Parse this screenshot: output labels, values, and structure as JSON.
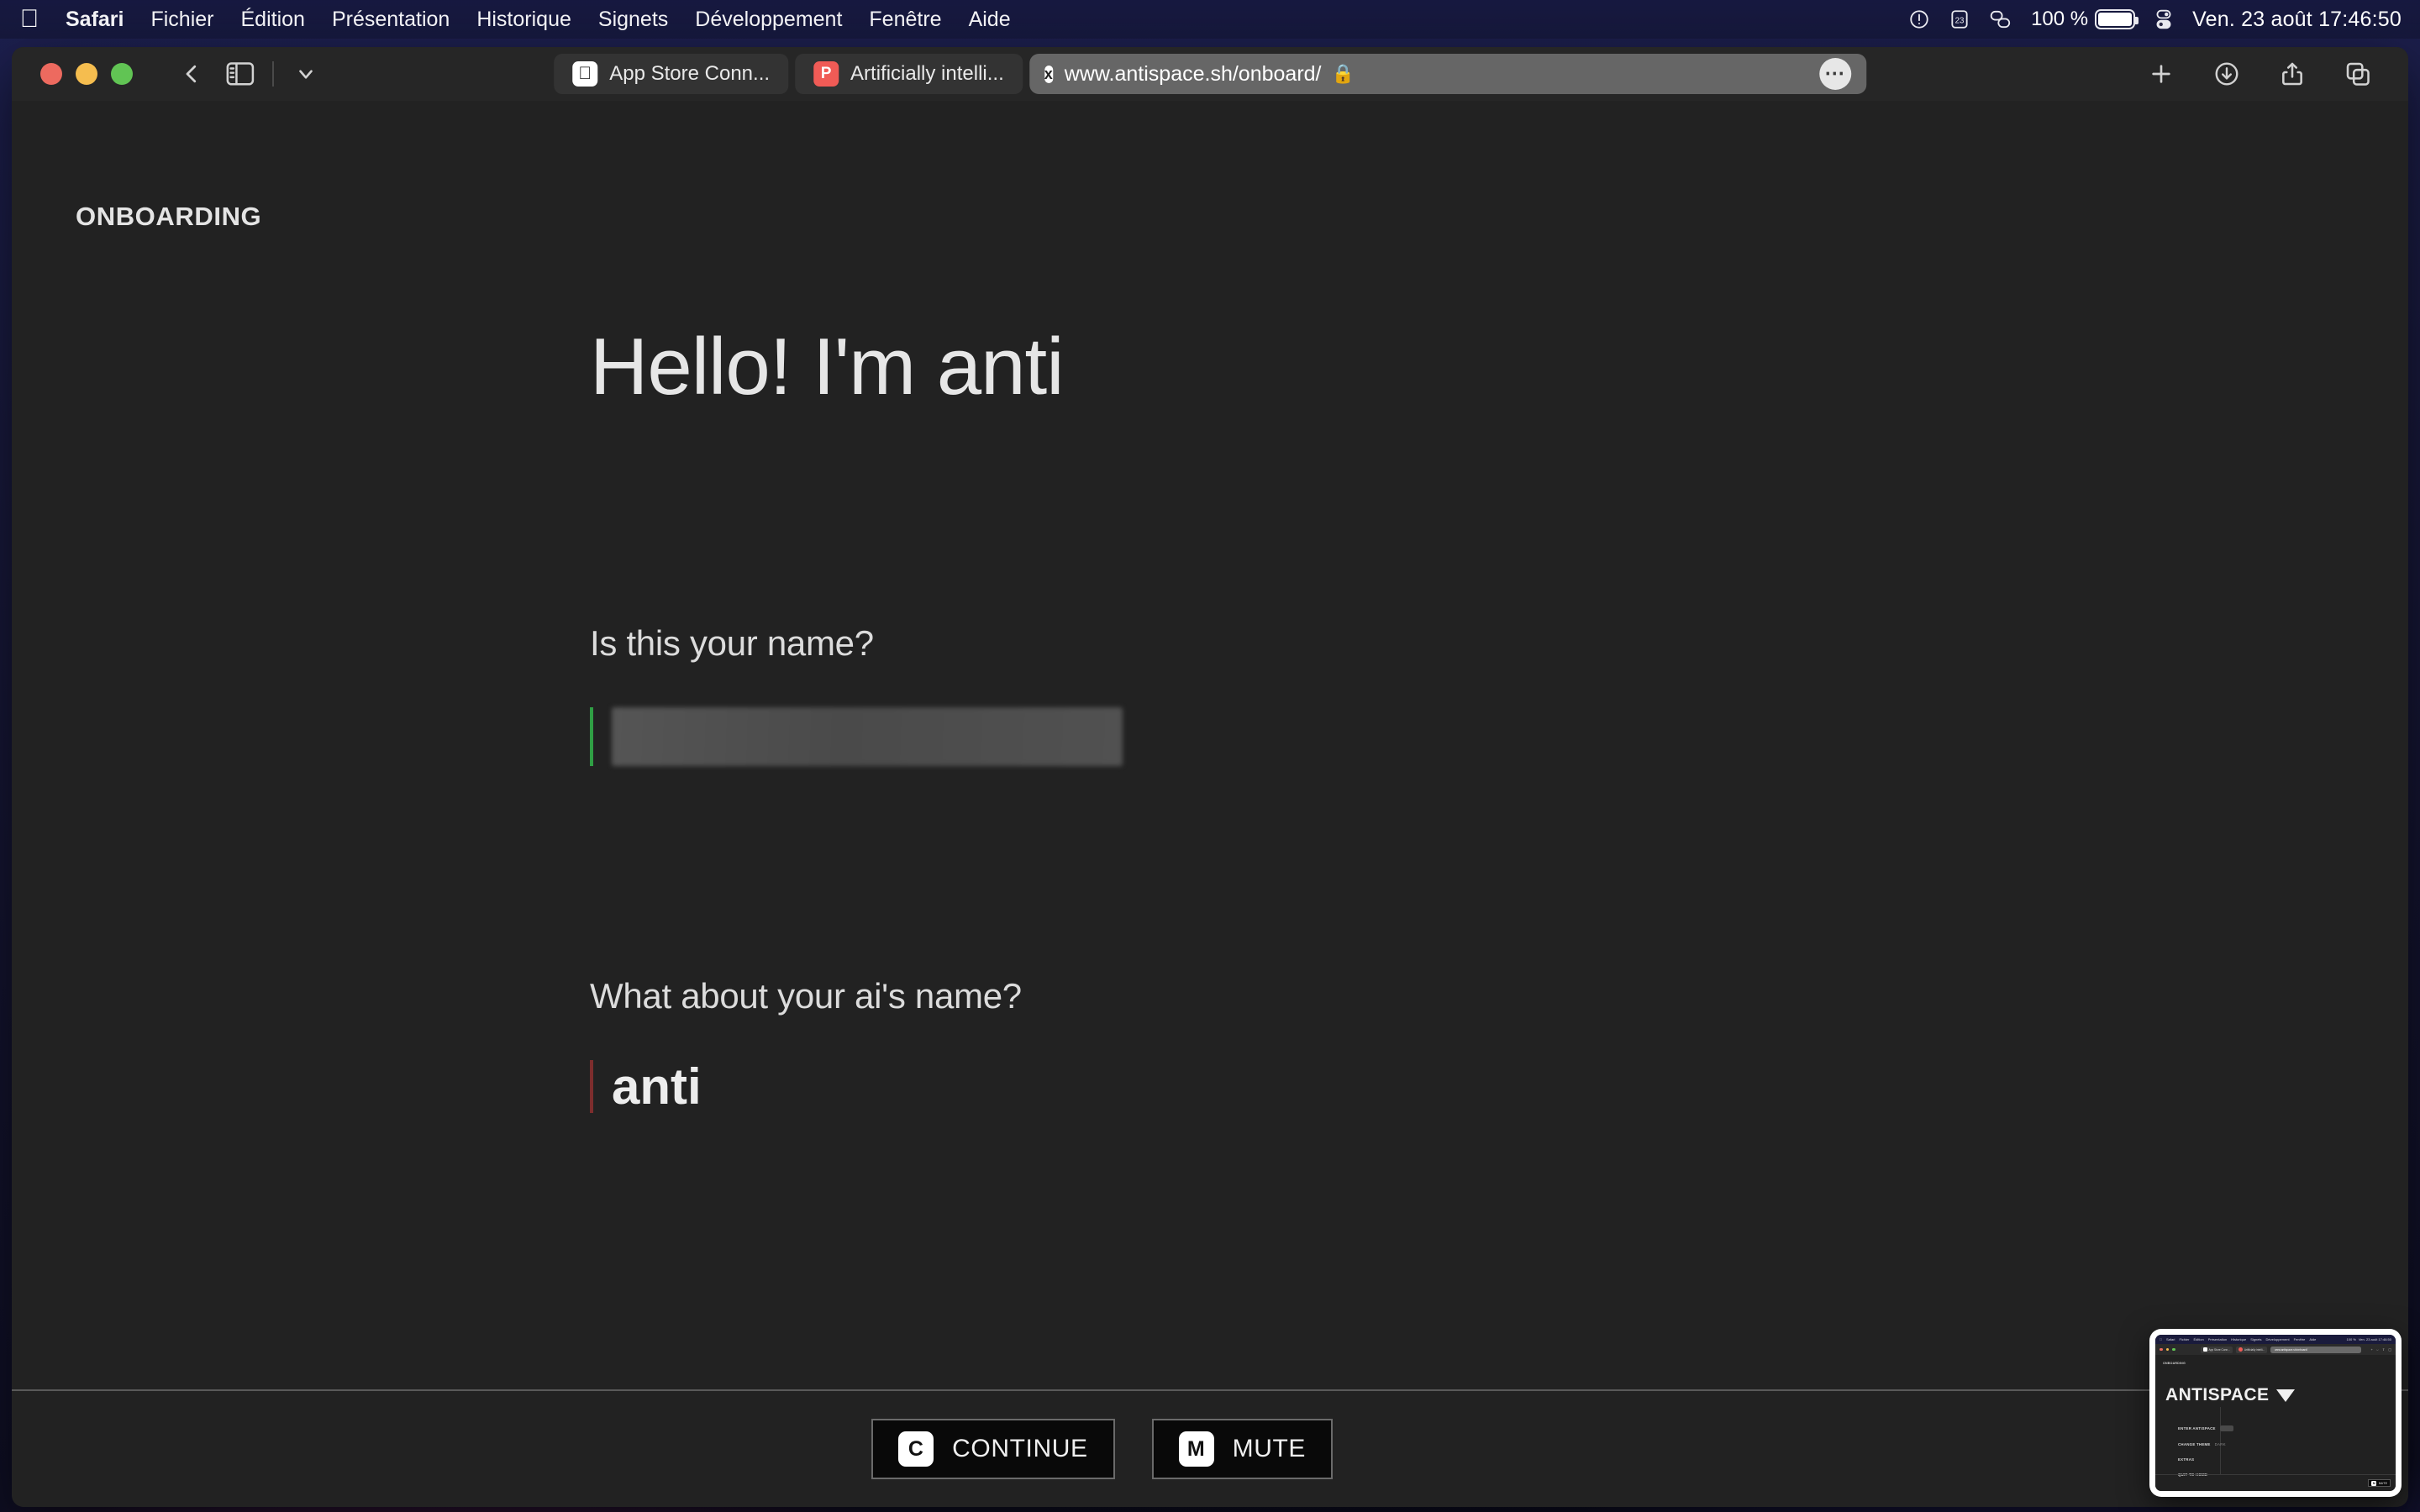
{
  "menubar": {
    "apple_icon": "apple-logo",
    "items": [
      {
        "label": "Safari",
        "bold": true
      },
      {
        "label": "Fichier",
        "bold": false
      },
      {
        "label": "Édition",
        "bold": false
      },
      {
        "label": "Présentation",
        "bold": false
      },
      {
        "label": "Historique",
        "bold": false
      },
      {
        "label": "Signets",
        "bold": false
      },
      {
        "label": "Développement",
        "bold": false
      },
      {
        "label": "Fenêtre",
        "bold": false
      },
      {
        "label": "Aide",
        "bold": false
      }
    ],
    "status": {
      "focus_icon": "clock-alert-icon",
      "calendar_icon": "calendar-icon",
      "calendar_day": "23",
      "link_icon": "chain-link-icon",
      "battery_percent": "100 %",
      "battery_icon": "battery-icon",
      "control_center_icon": "control-center-icon",
      "clock": "Ven. 23 août 17:46:50"
    }
  },
  "safari": {
    "window_controls": {
      "close": "close",
      "minimize": "minimize",
      "zoom": "zoom"
    },
    "back_icon": "chevron-left-icon",
    "sidebar_icon": "sidebar-toggle-icon",
    "chevron_icon": "chevron-down-icon",
    "tabs": [
      {
        "title": "App Store Conn...",
        "favicon": "apple-favicon",
        "favicon_glyph": "",
        "active": false
      },
      {
        "title": "Artificially intelli...",
        "favicon": "p-favicon",
        "favicon_glyph": "P",
        "active": false
      }
    ],
    "address": {
      "favicon": "x-favicon",
      "favicon_glyph": "x",
      "url": "www.antispace.sh/onboard/",
      "lock_icon": "lock-icon",
      "more_icon": "ellipsis-icon"
    },
    "toolbar_right": [
      {
        "icon": "plus-icon",
        "name": "new-tab-button"
      },
      {
        "icon": "download-icon",
        "name": "downloads-button"
      },
      {
        "icon": "share-icon",
        "name": "share-button"
      },
      {
        "icon": "tab-overview-icon",
        "name": "tab-overview-button"
      }
    ]
  },
  "page": {
    "brand": "ONBOARDING",
    "hero": "Hello! I'm anti",
    "questions": [
      {
        "label": "Is this your name?",
        "accent": "#2f9e44",
        "value": "",
        "redacted": true
      },
      {
        "label": "What about your ai's name?",
        "accent": "#7d2d2d",
        "value": "anti",
        "redacted": false
      }
    ],
    "actions": [
      {
        "key": "C",
        "label": "CONTINUE"
      },
      {
        "key": "M",
        "label": "MUTE"
      }
    ]
  },
  "pip": {
    "brand": "ONBOARDING",
    "title": "ANTISPACE",
    "caret_icon": "caret-down-icon",
    "menu_items": [
      {
        "label": "ENTER ANTISPACE",
        "sub": ""
      },
      {
        "label": "CHANGE THEME",
        "sub": "DARK"
      },
      {
        "label": "EXTRAS",
        "sub": ""
      },
      {
        "label": "QUIT TO HOME",
        "sub": ""
      }
    ],
    "mute": {
      "key": "M",
      "label": "MUTE"
    },
    "mini_tabs": [
      "App Store Conn...",
      "Artificially intelli..."
    ],
    "mini_url": "www.antispace.sh/onboard/"
  }
}
